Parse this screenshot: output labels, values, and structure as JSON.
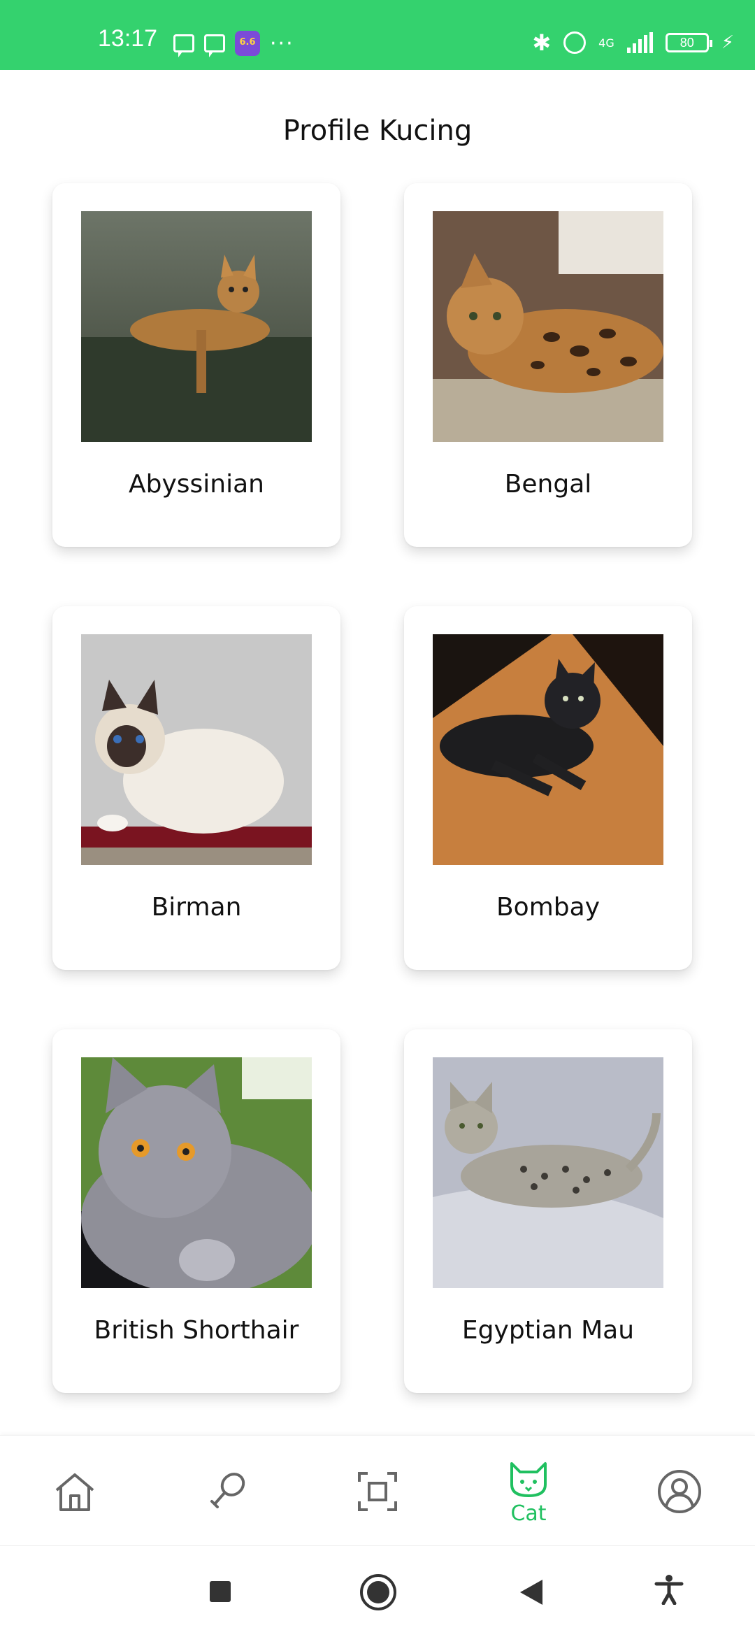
{
  "status_bar": {
    "time": "13:17",
    "app_badge": "6.6",
    "network": "4G",
    "battery": "80",
    "background_color": "#34d26e"
  },
  "header": {
    "title": "Profile Kucing"
  },
  "cats": [
    {
      "name": "Abyssinian"
    },
    {
      "name": "Bengal"
    },
    {
      "name": "Birman"
    },
    {
      "name": "Bombay"
    },
    {
      "name": "British Shorthair"
    },
    {
      "name": "Egyptian Mau"
    }
  ],
  "bottom_nav": {
    "items": [
      {
        "icon": "home-icon"
      },
      {
        "icon": "drumstick-icon"
      },
      {
        "icon": "scan-icon"
      },
      {
        "icon": "cat-icon",
        "label": "Cat",
        "active": true
      },
      {
        "icon": "profile-icon"
      }
    ],
    "active_color": "#20c060"
  },
  "system_nav": {
    "icons": [
      "recents-square-icon",
      "home-circle-icon",
      "back-triangle-icon",
      "accessibility-icon"
    ]
  }
}
